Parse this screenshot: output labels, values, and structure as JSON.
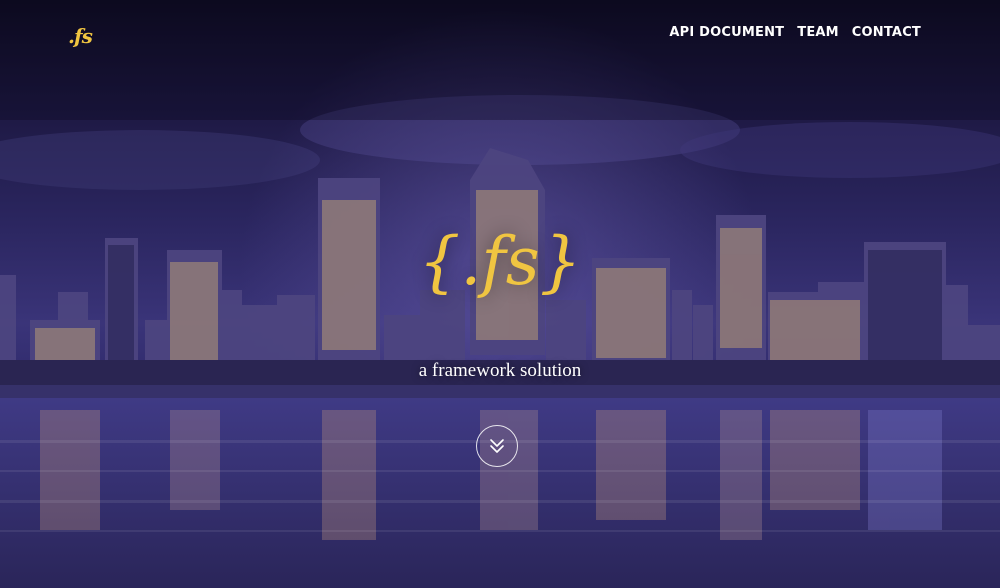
{
  "brand": {
    "small_logo": ".fs",
    "logo": "{.fs}",
    "tagline": "a framework solution"
  },
  "nav": {
    "items": [
      {
        "label": "API DOCUMENT"
      },
      {
        "label": "TEAM"
      },
      {
        "label": "CONTACT"
      }
    ]
  },
  "scroll_button": {
    "icon": "double-chevron-down-icon"
  },
  "colors": {
    "accent": "#f0c541",
    "overlay": "#2b2660",
    "text": "#ffffff"
  }
}
